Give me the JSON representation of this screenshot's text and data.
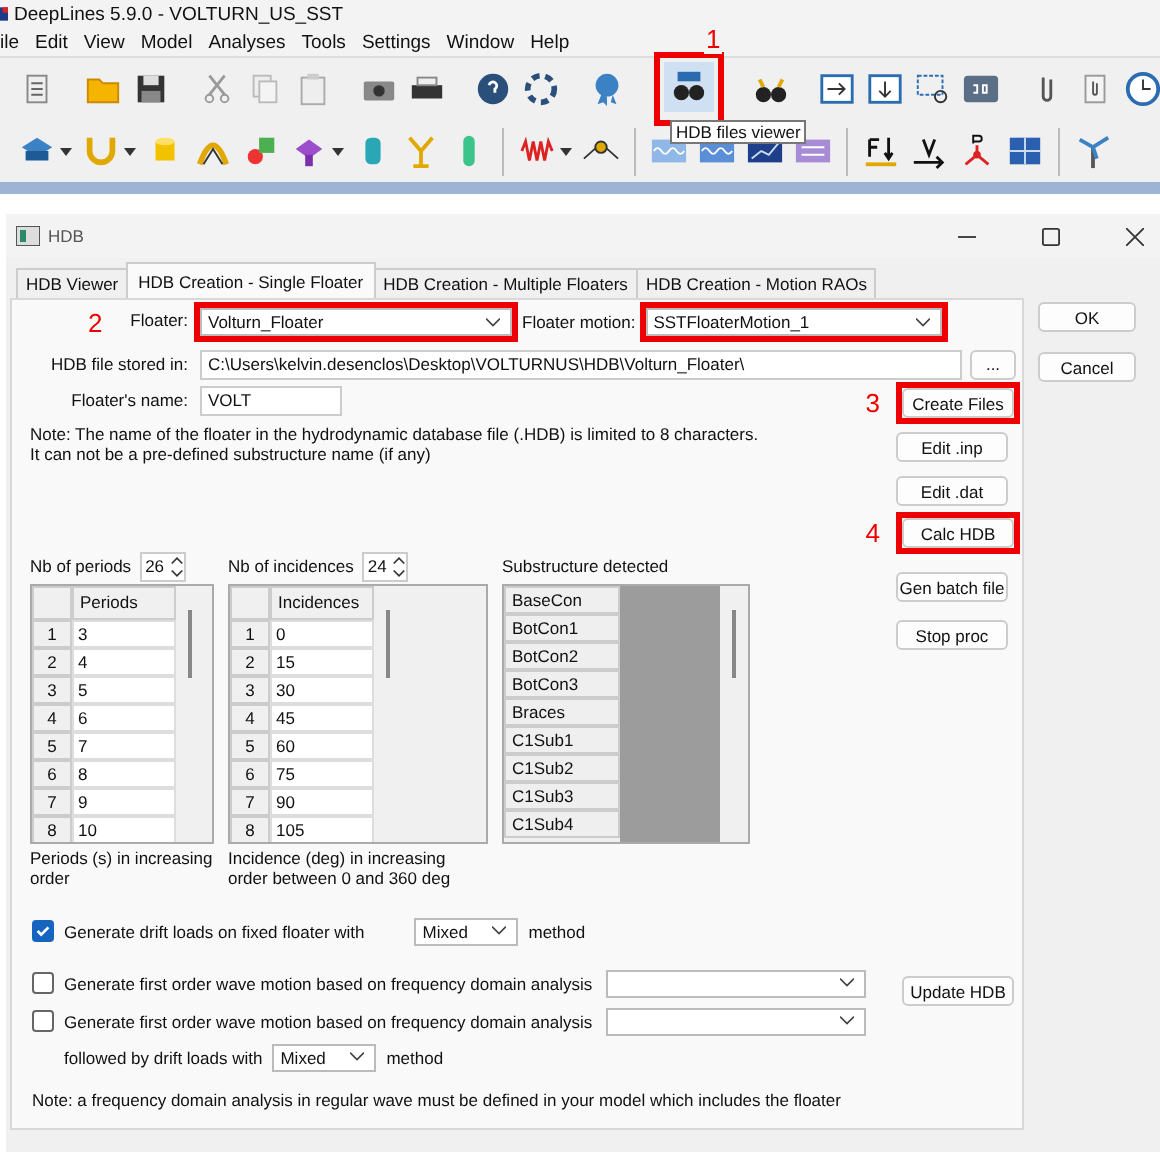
{
  "app": {
    "title": "DeepLines 5.9.0 - VOLTURN_US_SST",
    "menu": [
      "ile",
      "Edit",
      "View",
      "Model",
      "Analyses",
      "Tools",
      "Settings",
      "Window",
      "Help"
    ],
    "viewer_button": {
      "highlighted": true,
      "callout": "1",
      "tooltip": "HDB files viewer"
    }
  },
  "dialog": {
    "title": "HDB",
    "tabs": [
      {
        "label": "HDB Viewer",
        "selected": false
      },
      {
        "label": "HDB Creation - Single Floater",
        "selected": true
      },
      {
        "label": "HDB Creation - Multiple Floaters",
        "selected": false
      },
      {
        "label": "HDB Creation - Motion RAOs",
        "selected": false
      }
    ],
    "buttons": [
      "OK",
      "Cancel"
    ],
    "floater": {
      "callout": "2",
      "label": "Floater:",
      "value": "Volturn_Floater",
      "highlighted": true
    },
    "motion": {
      "label": "Floater motion:",
      "value": "SSTFloaterMotion_1",
      "highlighted": true
    },
    "path": {
      "label": "HDB file stored in:",
      "value": "C:\\Users\\kelvin.desenclos\\Desktop\\VOLTURNUS\\HDB\\Volturn_Floater\\",
      "browse": "..."
    },
    "name": {
      "label": "Floater's name:",
      "value": "VOLT"
    },
    "note": [
      "Note: The name of the floater in the hydrodynamic database file (.HDB) is limited to 8 characters.",
      "It can not be a pre-defined substructure name (if any)"
    ],
    "actions": [
      {
        "label": "Create Files",
        "highlighted": true,
        "callout": "3"
      },
      {
        "label": "Edit .inp",
        "highlighted": false
      },
      {
        "label": "Edit .dat",
        "highlighted": false
      },
      {
        "label": "Calc HDB",
        "highlighted": true,
        "callout": "4"
      },
      {
        "label": "Gen batch file",
        "highlighted": false
      },
      {
        "label": "Stop proc",
        "highlighted": false
      }
    ],
    "periods": {
      "label": "Nb of periods",
      "count": "26",
      "header": "Periods",
      "caption": "Periods (s) in increasing order",
      "rows": [
        [
          "1",
          "3"
        ],
        [
          "2",
          "4"
        ],
        [
          "3",
          "5"
        ],
        [
          "4",
          "6"
        ],
        [
          "5",
          "7"
        ],
        [
          "6",
          "8"
        ],
        [
          "7",
          "9"
        ],
        [
          "8",
          "10"
        ]
      ]
    },
    "incidences": {
      "label": "Nb of incidences",
      "count": "24",
      "header": "Incidences",
      "caption": "Incidence (deg) in increasing order between 0 and 360 deg",
      "rows": [
        [
          "1",
          "0"
        ],
        [
          "2",
          "15"
        ],
        [
          "3",
          "30"
        ],
        [
          "4",
          "45"
        ],
        [
          "5",
          "60"
        ],
        [
          "6",
          "75"
        ],
        [
          "7",
          "90"
        ],
        [
          "8",
          "105"
        ]
      ]
    },
    "substructures": {
      "label": "Substructure detected",
      "items": [
        "BaseCon",
        "BotCon1",
        "BotCon2",
        "BotCon3",
        "Braces",
        "C1Sub1",
        "C1Sub2",
        "C1Sub3",
        "C1Sub4"
      ]
    },
    "options": [
      {
        "kind": "check_method",
        "checked": true,
        "label": "Generate drift loads on fixed floater with",
        "method": "Mixed",
        "suffix": "method"
      },
      {
        "kind": "check_combo",
        "checked": false,
        "label": "Generate first order wave motion based on frequency domain analysis"
      },
      {
        "kind": "check_combo",
        "checked": false,
        "label": "Generate first order wave motion based on frequency domain analysis"
      },
      {
        "kind": "method",
        "label": "followed by drift loads with",
        "method": "Mixed",
        "suffix": "method"
      }
    ],
    "update": "Update HDB",
    "footnote": "Note: a frequency domain analysis in regular wave must be defined in your model which includes the floater"
  }
}
